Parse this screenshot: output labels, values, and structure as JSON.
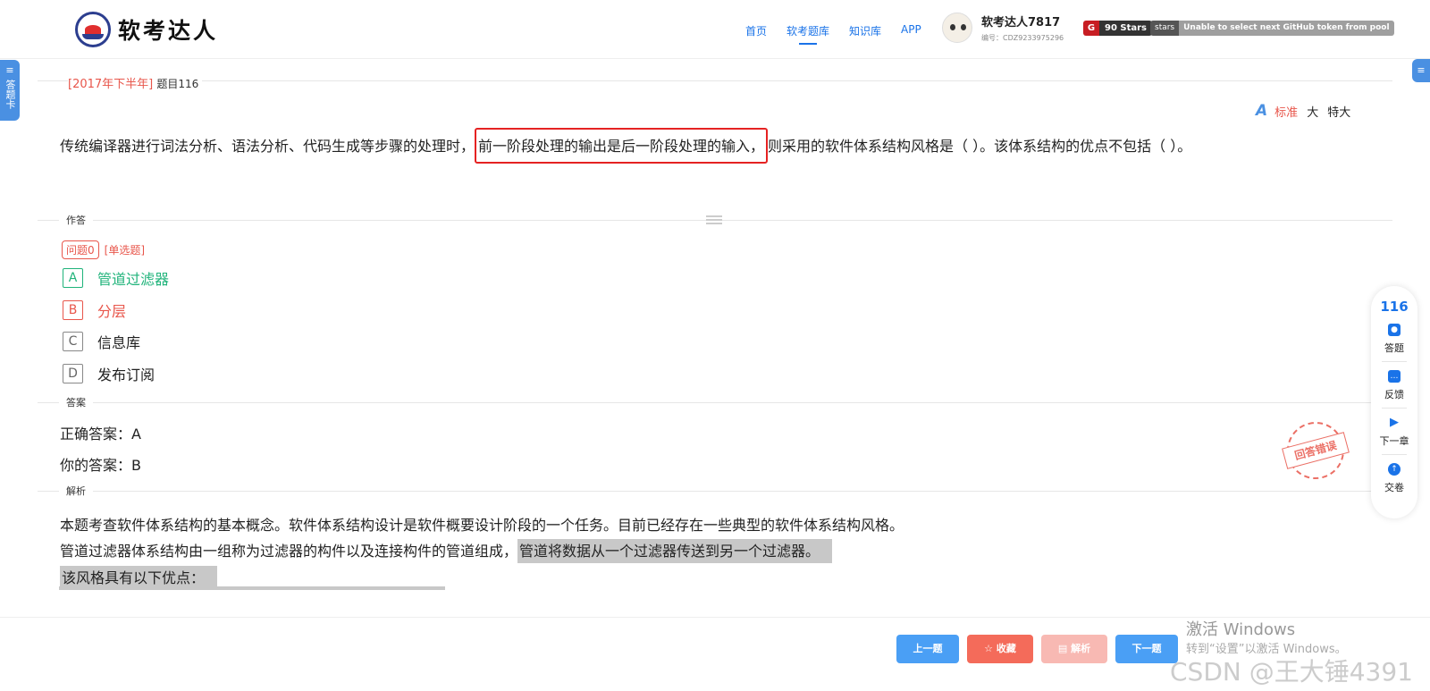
{
  "header": {
    "logo_text": "软考达人",
    "nav": [
      {
        "label": "首页",
        "active": false
      },
      {
        "label": "软考题库",
        "active": true
      },
      {
        "label": "知识库",
        "active": false
      },
      {
        "label": "APP",
        "active": false
      }
    ],
    "user_name": "软考达人7817",
    "user_id": "编号：CDZ9233975296",
    "stars_badge": "90 Stars",
    "github_label": "stars",
    "github_message": "Unable to select next GitHub token from pool"
  },
  "side": {
    "left_tab_label": "答题卡",
    "right_tab_icon": "menu-icon"
  },
  "question": {
    "year_tag": "[2017年下半年]",
    "number_label": "题目116",
    "font_sizes": {
      "standard": "标准",
      "large": "大",
      "xlarge": "特大",
      "active": "标准"
    },
    "stem_before": "传统编译器进行词法分析、语法分析、代码生成等步骤的处理时，",
    "stem_highlight": "前一阶段处理的输出是后一阶段处理的输入，",
    "stem_after": "则采用的软件体系结构风格是（ ）。该体系结构的优点不包括（ ）。"
  },
  "answer_section": {
    "section_label": "作答",
    "sub_question": "问题0",
    "type": "[单选题]",
    "options": [
      {
        "letter": "A",
        "text": "管道过滤器",
        "state": "correct"
      },
      {
        "letter": "B",
        "text": "分层",
        "state": "wrong"
      },
      {
        "letter": "C",
        "text": "信息库",
        "state": "normal"
      },
      {
        "letter": "D",
        "text": "发布订阅",
        "state": "normal"
      }
    ]
  },
  "result": {
    "section_label": "答案",
    "correct_answer": "正确答案：A",
    "your_answer": "你的答案：B",
    "stamp": "回答错误"
  },
  "analysis": {
    "section_label": "解析",
    "line1": "本题考查软件体系结构的基本概念。软件体系结构设计是软件概要设计阶段的一个任务。目前已经存在一些典型的软件体系结构风格。",
    "line2_plain": "管道过滤器体系结构由一组称为过滤器的构件以及连接构件的管道组成，",
    "line2_gray": "管道将数据从一个过滤器传送到另一个过滤器。",
    "line3_gray": "该风格具有以下优点："
  },
  "rail": {
    "number": "116",
    "items": [
      {
        "label": "答题",
        "icon": "answer-sheet-icon"
      },
      {
        "label": "反馈",
        "icon": "feedback-icon"
      },
      {
        "label": "下一章",
        "icon": "next-chapter-icon"
      },
      {
        "label": "交卷",
        "icon": "submit-icon"
      }
    ]
  },
  "footer": {
    "prev": "上一题",
    "favorite": "☆ 收藏",
    "analysis": "▤ 解析",
    "next": "下一题"
  },
  "watermark": {
    "activate_title": "激活 Windows",
    "activate_sub": "转到“设置”以激活 Windows。",
    "csdn": "CSDN @王大锤4391"
  },
  "colors": {
    "accent": "#1a73e8",
    "correct": "#1fb37a",
    "wrong": "#e8564b",
    "highlight_border": "#e52222"
  }
}
